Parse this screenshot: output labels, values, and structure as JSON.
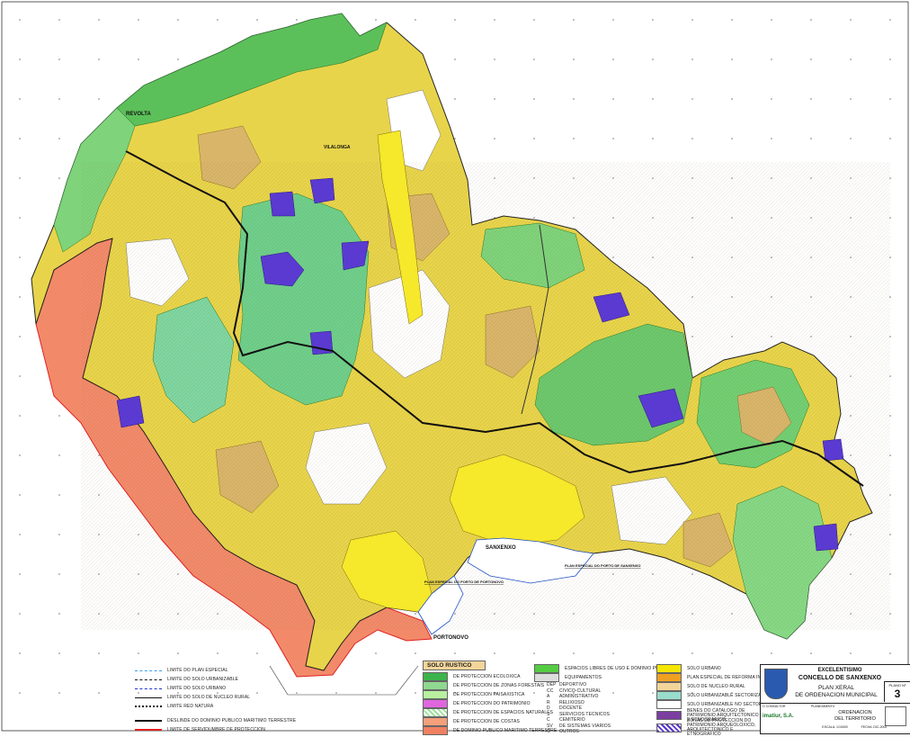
{
  "place_labels": {
    "revolta": "REVOLTA",
    "sanxenxo": "SANXENXO",
    "portonovo": "PORTONOVO",
    "vilalonga": "VILALONGA"
  },
  "port_labels": {
    "portonovo_plan": "PLAN ESPECIAL DO PORTO DE PORTONOVO",
    "sanxenxo_plan": "PLAN ESPECIAL DO PORTO DE SANXENXO"
  },
  "line_legend": {
    "items": [
      {
        "label": "LIMITE DO PLAN ESPECIAL",
        "color": "#3aa0e8",
        "style": "dashed"
      },
      {
        "label": "LIMITE DO SOLO URBANIZABLE",
        "color": "#111111",
        "style": "dashed"
      },
      {
        "label": "LIMITE DO SOLO URBANO",
        "color": "#2233cc",
        "style": "dashed"
      },
      {
        "label": "LIMITE DO SOLO DE NUCLEO RURAL",
        "color": "#111111",
        "style": "solid"
      },
      {
        "label": "LIMITE RED NATURA",
        "color": "#111111",
        "style": "dotted"
      },
      {
        "label": "DESLINDE DO DOMINIO PUBLICO MARITIMO TERRESTRE",
        "color": "#111111",
        "style": "solid"
      },
      {
        "label": "LIMITE DE SERVIDUMBRE DE PROTECCION",
        "color": "#e02020",
        "style": "solid"
      }
    ]
  },
  "rustic_legend": {
    "title": "SOLO RUSTICO",
    "items": [
      {
        "label": "DE PROTECCION ECOLOXICA",
        "color": "#3cb44b"
      },
      {
        "label": "DE PROTECCION DE ZONAS FORESTAIS",
        "color": "#8fd88f"
      },
      {
        "label": "DE PROTECCION PAISAXISTICA",
        "color": "#b8f0a0"
      },
      {
        "label": "DE PROTECCION DO PATRIMONIO",
        "color": "#e066e0"
      },
      {
        "label": "DE PROTECCION DE ESPACIOS NATURALES",
        "color": "#9ee09e"
      },
      {
        "label": "DE PROTECCION DE COSTAS",
        "color": "#f4a07a"
      },
      {
        "label": "DE DOMINIO PUBLICO MARITIMO TERRESTRE",
        "color": "#f08060"
      }
    ]
  },
  "equip_legend": {
    "spaces_label": "ESPACIOS LIBRES DE USO E DOMINIO PUBLICO",
    "spaces_color": "#55cc44",
    "equip_label": "EQUIPAMENTOS",
    "equip_color": "#dddddd",
    "items": [
      {
        "code": "DEP",
        "label": "DEPORTIVO"
      },
      {
        "code": "CC",
        "label": "CIVICO-CULTURAL"
      },
      {
        "code": "A",
        "label": "ADMINISTRATIVO"
      },
      {
        "code": "R",
        "label": "RELIXIOSO"
      },
      {
        "code": "D",
        "label": "DOCENTE"
      },
      {
        "code": "S",
        "label": "SERVICIOS TECNICOS"
      },
      {
        "code": "C",
        "label": "CEMITERIO"
      },
      {
        "code": "SV",
        "label": "DE SISTEMAS VIARIOS"
      },
      {
        "code": "O",
        "label": "OUTROS"
      }
    ]
  },
  "urban_legend": {
    "items": [
      {
        "label": "SOLO URBANO",
        "color": "#f5e600"
      },
      {
        "label": "PLAN ESPECIAL DE REFORMA INTERIOR",
        "color": "#f0a020"
      },
      {
        "label": "SOLO DE NUCLEO RURAL",
        "color": "#f3d59a"
      },
      {
        "label": "SOLO URBANIZABLE SECTORIZADO",
        "color": "#99ddcc"
      },
      {
        "label": "SOLO URBANIZABLE NO SECTORIZADO",
        "color": "#ffffff"
      },
      {
        "label": "BENES DO CATALOGO DE PATRIMONIO ARQUITECTONICO E ETNOGRAFICO",
        "color": "#7b3fa0"
      },
      {
        "label": "ZONAS DE PROTECCION DO PATRIMONIO ARQUEOLOXICO, ARQUITECTONICO E ETNOGRAFICO",
        "color": "#5533cc"
      }
    ]
  },
  "title_block": {
    "line1": "EXCELENTISIMO",
    "line2": "CONCELLO DE SANXENXO",
    "plan_title": "PLAN XERAL",
    "plan_subtitle": "DE ORDENACION MUNICIPAL",
    "sheet_label": "PLANO Nº",
    "sheet_number": "3",
    "consultant_label": "O CONSULTOR",
    "planning_label": "PLANEAMENTO",
    "consultant": "imatiur, S.A.",
    "subject1": "ORDENACION",
    "subject2": "DEL TERRITORIO",
    "scale": "ESCALA: 1/10000",
    "date": "FECHA: DIC-2002"
  },
  "colors": {
    "forest": "#66cc66",
    "urban": "#e8d840",
    "rural": "#d9b96a",
    "coast": "#f28a6a",
    "heritage": "#5a3ad0",
    "sea": "#ffffff"
  }
}
